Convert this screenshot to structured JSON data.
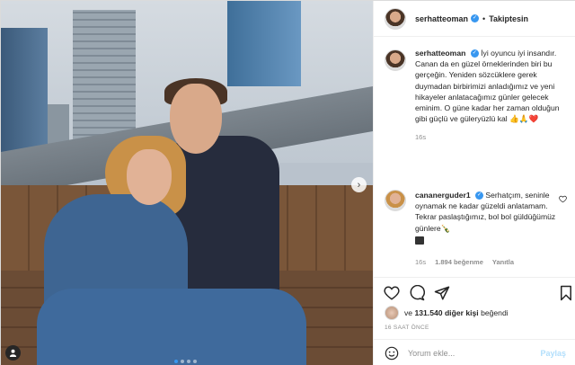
{
  "header": {
    "username": "serhatteoman",
    "separator": "•",
    "follow_label": "Takiptesin"
  },
  "caption": {
    "username": "serhatteoman",
    "text": "İyi oyuncu iyi insandır. Canan da en güzel örneklerinden biri bu gerçeğin. Yeniden sözcüklere gerek duymadan birbirimizi anladığımız ve yeni hikayeler anlatacağımız günler gelecek eminim. O güne kadar her zaman olduğun gibi güçlü ve güleryüzlü kal 👍🙏❤️",
    "time": "16s"
  },
  "comment": {
    "username": "cananerguder1",
    "text": "Serhatçım, seninle oynamak ne kadar güzeldi anlatamam. Tekrar paslaştığımız, bol bol güldüğümüz günlere🍾",
    "time": "16s",
    "likes": "1.894 beğenme",
    "reply": "Yanıtla"
  },
  "likes": {
    "prefix": "ve",
    "count": "131.540",
    "suffix": "diğer kişi",
    "verb": "beğendi"
  },
  "posted_ago": "16 SAAT ÖNCE",
  "add_comment": {
    "placeholder": "Yorum ekle...",
    "post_label": "Paylaş"
  },
  "icons": {
    "arrow": "chevron-right-icon",
    "heart": "heart-icon",
    "comment": "comment-icon",
    "share": "share-icon",
    "save": "bookmark-icon",
    "emoji": "emoji-icon"
  },
  "colors": {
    "accent": "#3897f0",
    "muted": "#8e8e8e",
    "post_disabled": "#b2dffc"
  }
}
